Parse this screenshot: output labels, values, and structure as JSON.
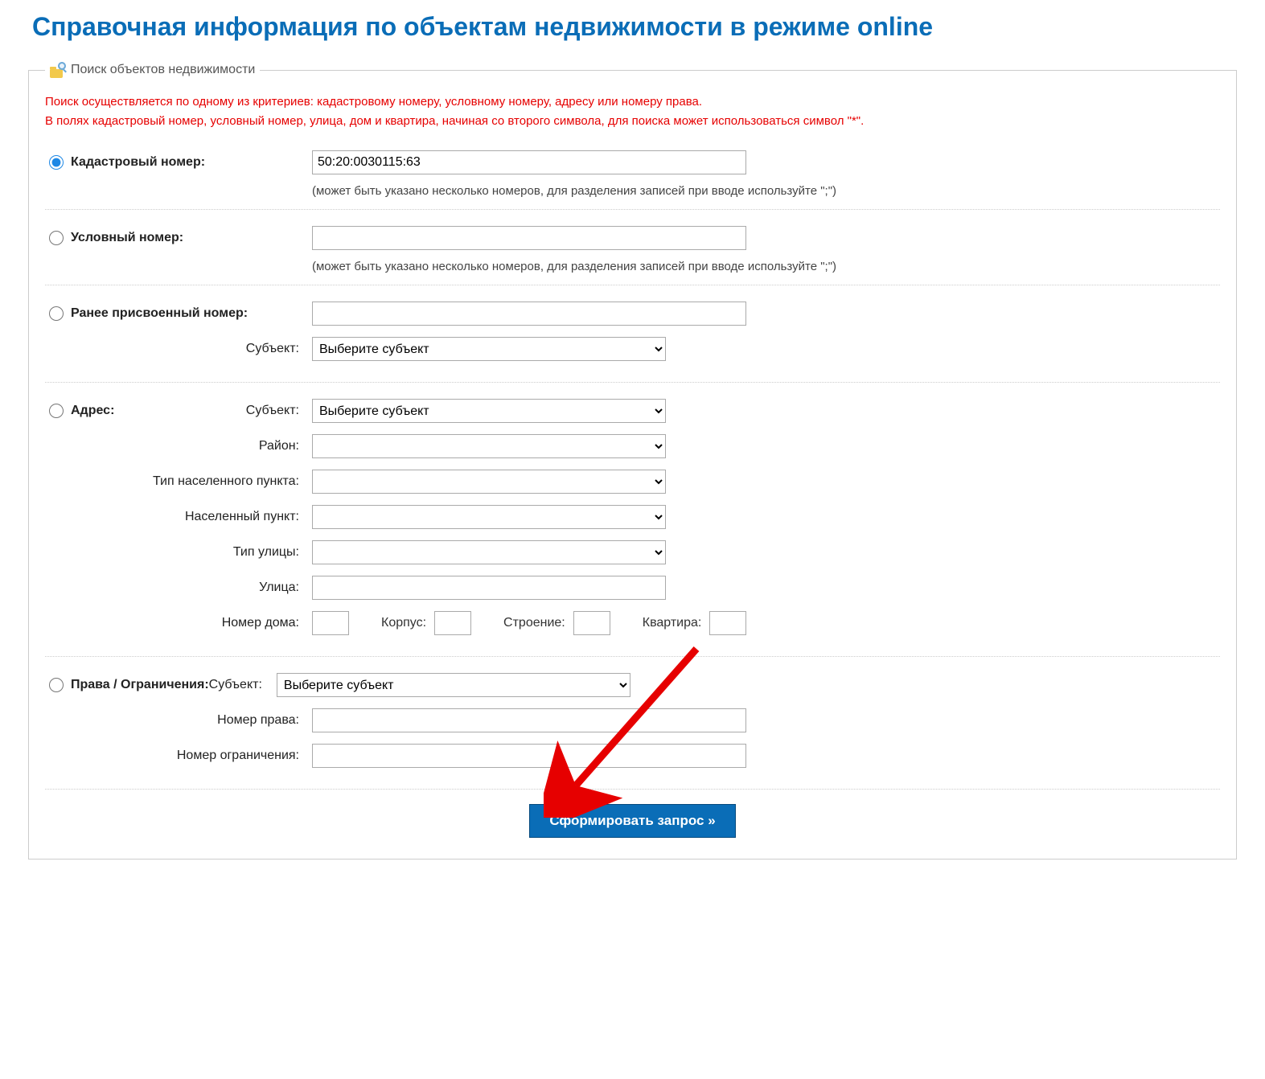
{
  "page_title": "Справочная информация по объектам недвижимости в режиме online",
  "legend": "Поиск объектов недвижимости",
  "hint_line1": "Поиск осуществляется по одному из критериев: кадастровому номеру, условному номеру, адресу или номеру права.",
  "hint_line2": "В полях кадастровый номер, условный номер, улица, дом и квартира, начиная со второго символа, для поиска может использоваться символ \"*\".",
  "cadastral": {
    "radio_label": "Кадастровый номер:",
    "value": "50:20:0030115:63",
    "note": "(может быть указано несколько номеров, для разделения записей при вводе используйте \";\")"
  },
  "conditional": {
    "radio_label": "Условный номер:",
    "value": "",
    "note": "(может быть указано несколько номеров, для разделения записей при вводе используйте \";\")"
  },
  "previous": {
    "radio_label": "Ранее присвоенный номер:",
    "value": "",
    "subject_label": "Субъект:",
    "subject_option": "Выберите субъект"
  },
  "address": {
    "radio_label": "Адрес:",
    "subject_label": "Субъект:",
    "subject_option": "Выберите субъект",
    "district_label": "Район:",
    "settlement_type_label": "Тип населенного пункта:",
    "settlement_label": "Населенный пункт:",
    "street_type_label": "Тип улицы:",
    "street_label": "Улица:",
    "house_label": "Номер дома:",
    "korpus_label": "Корпус:",
    "building_label": "Строение:",
    "flat_label": "Квартира:"
  },
  "rights": {
    "radio_label": "Права / Ограничения:",
    "subject_label": "Субъект:",
    "subject_option": "Выберите субъект",
    "right_no_label": "Номер права:",
    "limit_no_label": "Номер ограничения:"
  },
  "submit_label": "Сформировать запрос »"
}
